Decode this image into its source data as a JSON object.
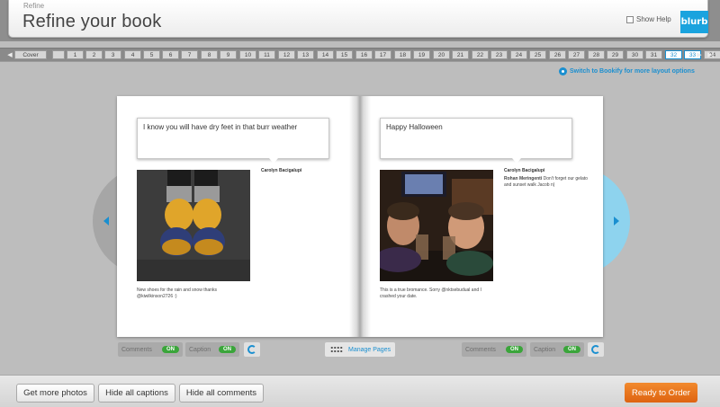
{
  "header": {
    "section_label": "Refine",
    "title": "Refine your book",
    "show_help_label": "Show Help",
    "logo_text": "blurb"
  },
  "page_nav": {
    "pages": [
      "Cover",
      "",
      "1",
      "2",
      "3",
      "4",
      "5",
      "6",
      "7",
      "8",
      "9",
      "10",
      "11",
      "12",
      "13",
      "14",
      "15",
      "16",
      "17",
      "18",
      "19",
      "20",
      "21",
      "22",
      "23",
      "24",
      "25",
      "26",
      "27",
      "28",
      "29",
      "30",
      "31",
      "32",
      "33",
      "34",
      "35"
    ],
    "active_pages": [
      "32",
      "33"
    ]
  },
  "switch_link": "Switch to Bookify for more layout options",
  "left_page": {
    "comment": "I know you will have dry feet in that burr weather",
    "author": "Carolyn Bacigalupi",
    "caption": "New shoes for the rain and snow thanks @kiwilkinson2726 :)"
  },
  "right_page": {
    "comment": "Happy Halloween",
    "author": "Carolyn Bacigalupi",
    "reply_author": "Rohan Meringenti",
    "reply_text": "Don't forget our gelato and sunset walk Jacob n)",
    "caption": "This is a true bromance. Sorry @nktsebudual and I crashed your date."
  },
  "controls": {
    "comments_label": "Comments",
    "caption_label": "Caption",
    "on_label": "ON",
    "manage_pages": "Manage Pages"
  },
  "bottom": {
    "get_more_photos": "Get more photos",
    "hide_captions": "Hide all captions",
    "hide_comments": "Hide all comments",
    "ready_to_order": "Ready to Order"
  },
  "colors": {
    "accent": "#1a8fd0",
    "order_orange": "#e9731f",
    "toggle_green": "#3aa53a"
  }
}
